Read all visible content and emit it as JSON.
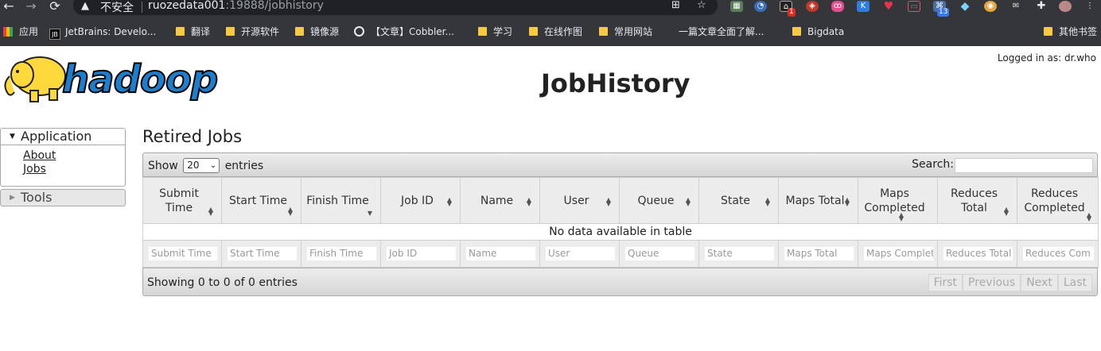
{
  "browser": {
    "insecure_label": "不安全",
    "url_host": "ruozedata001",
    "url_path": ":19888/jobhistory",
    "extension_badges": {
      "notify": "1",
      "tasks": "13"
    },
    "bookmarks": [
      {
        "label": "应用",
        "icon": "apps-grid-icon"
      },
      {
        "label": "JetBrains: Develo...",
        "icon": "jetbrains-icon"
      },
      {
        "label": "翻译",
        "icon": "folder-icon"
      },
      {
        "label": "开源软件",
        "icon": "folder-icon"
      },
      {
        "label": "镜像源",
        "icon": "folder-icon"
      },
      {
        "label": "【文章】Cobbler...",
        "icon": "globe-icon"
      },
      {
        "label": "学习",
        "icon": "folder-icon"
      },
      {
        "label": "在线作图",
        "icon": "folder-icon"
      },
      {
        "label": "常用网站",
        "icon": "folder-icon"
      },
      {
        "label": "一篇文章全面了解...",
        "icon": "page-icon"
      },
      {
        "label": "Bigdata",
        "icon": "folder-icon"
      },
      {
        "label": "其他书签",
        "icon": "folder-icon"
      }
    ]
  },
  "header": {
    "logo_text": "hadoop",
    "title": "JobHistory",
    "logged_in": "Logged in as: dr.who"
  },
  "sidebar": {
    "application_label": "Application",
    "links": [
      "About",
      "Jobs"
    ],
    "tools_label": "Tools"
  },
  "main": {
    "section_title": "Retired Jobs",
    "show_label": "Show",
    "page_size": "20",
    "entries_label": "entries",
    "search_label": "Search:",
    "columns": [
      "Submit Time",
      "Start Time",
      "Finish Time",
      "Job ID",
      "Name",
      "User",
      "Queue",
      "State",
      "Maps Total",
      "Maps Completed",
      "Reduces Total",
      "Reduces Completed"
    ],
    "empty_message": "No data available in table",
    "filter_placeholders": [
      "Submit Time",
      "Start Time",
      "Finish Time",
      "Job ID",
      "Name",
      "User",
      "Queue",
      "State",
      "Maps Total",
      "Maps Complet",
      "Reduces Total",
      "Reduces Com"
    ],
    "info": "Showing 0 to 0 of 0 entries",
    "pager": [
      "First",
      "Previous",
      "Next",
      "Last"
    ]
  },
  "colors": {
    "browser_bg": "#35363a",
    "logo_blue": "#1b7fd0",
    "elephant": "#ffd93b"
  }
}
